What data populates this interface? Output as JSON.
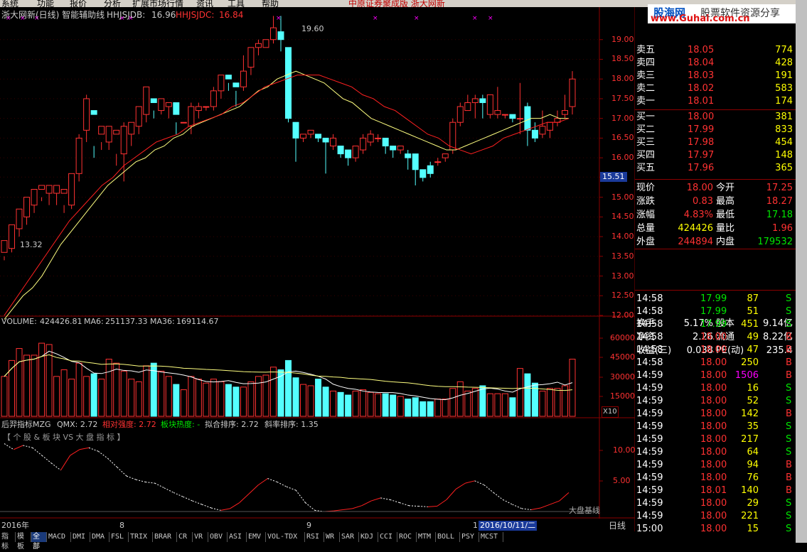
{
  "menu": [
    "系统",
    "功能",
    "报价",
    "分析",
    "扩展市场行情",
    "资讯",
    "工具",
    "帮助"
  ],
  "banner": "中原证券聚成版  浙大网新",
  "chart_header": {
    "title": "浙大网新(日线) 智能辅助线",
    "l1_label": "HHJSJDB:",
    "l1_value": "16.96",
    "l2_label": "HHJSJDC:",
    "l2_value": "16.84"
  },
  "logo": {
    "brand": "股海网",
    "slogan": "股票软件资源分享",
    "url": "www.Guhai.com.cn"
  },
  "price_axis": [
    "19.00",
    "18.50",
    "18.00",
    "17.50",
    "17.00",
    "16.50",
    "16.00",
    "15.51",
    "15.00",
    "14.50",
    "14.00",
    "13.50",
    "13.00",
    "12.50",
    "12.00"
  ],
  "annot": {
    "high": "19.60",
    "low": "13.32"
  },
  "volume_header": {
    "label": "VOLUME:",
    "volume": "424426.81",
    "ma6_label": "MA6:",
    "ma6": "251137.33",
    "ma36_label": "MA36:",
    "ma36": "169114.67"
  },
  "volume_axis": [
    "60000",
    "45000",
    "30000",
    "15000"
  ],
  "volume_unit": "X10",
  "indicator_header": {
    "name": "后羿指标MZG",
    "qmx": "QMX: 2.72",
    "rel": "相对强度: 2.72",
    "heat": "板块热度: -",
    "fit": "拟合排序: 2.72",
    "slope": "斜率排序: 1.35"
  },
  "indicator_sub": "【 个 股 & 板 块 VS 大 盘 指 标 】",
  "indicator_axis": [
    "10.00",
    "5.00"
  ],
  "indicator_note": "大盘基线",
  "date_axis": {
    "year": "2016年",
    "m8": "8",
    "m9": "9",
    "m10": "1",
    "cursor": "2016/10/11/二"
  },
  "period": "日线",
  "tabs": [
    "指标",
    "模板",
    "全部",
    "MACD",
    "DMI",
    "DMA",
    "FSL",
    "TRIX",
    "BRAR",
    "CR",
    "VR",
    "OBV",
    "ASI",
    "EMV",
    "VOL-TDX",
    "RSI",
    "WR",
    "SAR",
    "KDJ",
    "CCI",
    "ROC",
    "MTM",
    "BOLL",
    "PSY",
    "MCST"
  ],
  "orderbook": {
    "asks": [
      {
        "label": "卖五",
        "price": "18.05",
        "vol": "774"
      },
      {
        "label": "卖四",
        "price": "18.04",
        "vol": "428"
      },
      {
        "label": "卖三",
        "price": "18.03",
        "vol": "191"
      },
      {
        "label": "卖二",
        "price": "18.02",
        "vol": "583"
      },
      {
        "label": "卖一",
        "price": "18.01",
        "vol": "174"
      }
    ],
    "bids": [
      {
        "label": "买一",
        "price": "18.00",
        "vol": "381"
      },
      {
        "label": "买二",
        "price": "17.99",
        "vol": "833"
      },
      {
        "label": "买三",
        "price": "17.98",
        "vol": "454"
      },
      {
        "label": "买四",
        "price": "17.97",
        "vol": "148"
      },
      {
        "label": "买五",
        "price": "17.96",
        "vol": "365"
      }
    ]
  },
  "stats": [
    {
      "l1": "现价",
      "v1": "18.00",
      "l2": "今开",
      "v2": "17.25"
    },
    {
      "l1": "涨跌",
      "v1": "0.83",
      "l2": "最高",
      "v2": "18.27"
    },
    {
      "l1": "涨幅",
      "v1": "4.83%",
      "l2": "最低",
      "v2": "17.18"
    },
    {
      "l1": "总量",
      "v1": "424426",
      "l2": "量比",
      "v2": "1.96"
    },
    {
      "l1": "外盘",
      "v1": "244894",
      "l2": "内盘",
      "v2": "179532"
    },
    {
      "l1": "换手",
      "v1": "5.17%",
      "l2": "股本",
      "v2": "9.14亿"
    },
    {
      "l1": "净资",
      "v1": "2.26",
      "l2": "流通",
      "v2": "8.22亿"
    },
    {
      "l1": "收益(三)",
      "v1": "0.038",
      "l2": "PE(动)",
      "v2": "235.4"
    }
  ],
  "ticks": [
    {
      "t": "14:58",
      "p": "17.99",
      "v": "87",
      "s": "S"
    },
    {
      "t": "14:58",
      "p": "17.99",
      "v": "51",
      "s": "S"
    },
    {
      "t": "14:58",
      "p": "17.99",
      "v": "451",
      "s": "S"
    },
    {
      "t": "14:58",
      "p": "18.00",
      "v": "49",
      "s": "B"
    },
    {
      "t": "14:58",
      "p": "18.00",
      "v": "47",
      "s": "B"
    },
    {
      "t": "14:58",
      "p": "18.00",
      "v": "250",
      "s": "B"
    },
    {
      "t": "14:59",
      "p": "18.00",
      "v": "1506",
      "s": "B"
    },
    {
      "t": "14:59",
      "p": "18.00",
      "v": "16",
      "s": "S"
    },
    {
      "t": "14:59",
      "p": "18.00",
      "v": "52",
      "s": "S"
    },
    {
      "t": "14:59",
      "p": "18.00",
      "v": "142",
      "s": "B"
    },
    {
      "t": "14:59",
      "p": "18.00",
      "v": "35",
      "s": "S"
    },
    {
      "t": "14:59",
      "p": "18.00",
      "v": "217",
      "s": "S"
    },
    {
      "t": "14:59",
      "p": "18.00",
      "v": "64",
      "s": "S"
    },
    {
      "t": "14:59",
      "p": "18.00",
      "v": "94",
      "s": "B"
    },
    {
      "t": "14:59",
      "p": "18.00",
      "v": "76",
      "s": "B"
    },
    {
      "t": "14:59",
      "p": "18.01",
      "v": "140",
      "s": "B"
    },
    {
      "t": "14:59",
      "p": "18.00",
      "v": "29",
      "s": "S"
    },
    {
      "t": "14:59",
      "p": "18.00",
      "v": "221",
      "s": "S"
    },
    {
      "t": "15:00",
      "p": "18.00",
      "v": "15",
      "s": "S"
    }
  ],
  "colors": {
    "up": "#ff3232",
    "down": "#54ffff",
    "ma_short": "#ffff80",
    "ma_long": "#ff2020",
    "grid": "#8b0000"
  },
  "chart_data": {
    "type": "candlestick",
    "candles": [
      [
        13.6,
        13.9,
        13.5,
        13.4
      ],
      [
        13.7,
        14.3,
        14.2,
        13.6
      ],
      [
        14.2,
        14.7,
        14.5,
        14.0
      ],
      [
        14.5,
        15.0,
        14.9,
        14.3
      ],
      [
        14.8,
        15.2,
        15.1,
        14.6
      ],
      [
        15.2,
        15.3,
        15.0,
        14.9
      ],
      [
        15.1,
        15.3,
        15.2,
        14.8
      ],
      [
        15.1,
        15.3,
        15.2,
        14.8
      ],
      [
        15.1,
        15.2,
        14.8,
        14.6
      ],
      [
        14.8,
        15.6,
        15.6,
        14.7
      ],
      [
        15.6,
        16.5,
        16.6,
        15.4
      ],
      [
        16.7,
        17.5,
        17.6,
        16.4
      ],
      [
        17.2,
        17.1,
        16.3,
        16.0
      ],
      [
        16.6,
        16.8,
        16.4,
        16.2
      ],
      [
        16.4,
        16.8,
        16.6,
        16.2
      ],
      [
        16.6,
        16.7,
        16.1,
        15.8
      ],
      [
        16.1,
        16.8,
        16.9,
        15.4
      ],
      [
        16.6,
        16.9,
        16.8,
        16.3
      ],
      [
        16.8,
        17.3,
        17.3,
        16.6
      ],
      [
        17.1,
        17.8,
        17.8,
        16.9
      ],
      [
        17.5,
        17.4,
        17.2,
        17.0
      ],
      [
        17.2,
        17.5,
        17.4,
        17.1
      ],
      [
        17.3,
        17.4,
        17.4,
        17.0
      ],
      [
        17.4,
        17.1,
        16.9,
        16.6
      ],
      [
        16.9,
        16.9,
        16.6,
        16.6
      ],
      [
        16.8,
        17.3,
        17.4,
        16.6
      ],
      [
        17.2,
        17.3,
        17.4,
        17.0
      ],
      [
        17.3,
        17.3,
        17.3,
        17.2
      ],
      [
        17.3,
        17.7,
        17.8,
        17.2
      ],
      [
        17.7,
        18.1,
        18.1,
        17.5
      ],
      [
        18.1,
        18.0,
        17.9,
        17.7
      ],
      [
        17.9,
        17.8,
        17.7,
        17.3
      ],
      [
        17.8,
        18.2,
        18.6,
        17.7
      ],
      [
        18.3,
        18.8,
        18.8,
        18.1
      ],
      [
        18.8,
        18.9,
        19.0,
        18.6
      ],
      [
        18.8,
        19.0,
        19.0,
        18.8
      ],
      [
        19.0,
        19.3,
        19.6,
        18.9
      ],
      [
        19.2,
        19.0,
        19.6,
        18.7
      ],
      [
        18.8,
        17.0,
        18.8,
        16.9
      ],
      [
        16.9,
        16.5,
        16.9,
        15.9
      ],
      [
        16.5,
        16.6,
        16.6,
        16.4
      ],
      [
        16.6,
        16.7,
        16.7,
        16.5
      ],
      [
        16.6,
        16.5,
        16.6,
        16.4
      ],
      [
        16.5,
        16.4,
        16.5,
        15.6
      ],
      [
        16.3,
        16.5,
        16.6,
        16.2
      ],
      [
        16.3,
        16.1,
        16.3,
        16.0
      ],
      [
        16.2,
        16.0,
        16.2,
        15.8
      ],
      [
        16.0,
        16.3,
        16.3,
        15.9
      ],
      [
        16.2,
        16.5,
        16.6,
        16.1
      ],
      [
        16.4,
        16.6,
        16.7,
        16.3
      ],
      [
        16.5,
        16.5,
        16.6,
        16.4
      ],
      [
        16.5,
        16.3,
        16.4,
        16.1
      ],
      [
        16.3,
        16.2,
        16.3,
        16.0
      ],
      [
        16.2,
        16.3,
        16.3,
        16.1
      ],
      [
        16.1,
        16.0,
        16.2,
        15.7
      ],
      [
        16.1,
        15.7,
        16.1,
        15.3
      ],
      [
        15.7,
        15.5,
        15.7,
        15.4
      ],
      [
        15.8,
        15.6,
        15.9,
        15.5
      ],
      [
        15.9,
        15.9,
        16.0,
        15.8
      ],
      [
        16.0,
        16.1,
        16.1,
        15.9
      ],
      [
        16.2,
        16.9,
        17.0,
        16.1
      ],
      [
        16.9,
        17.3,
        17.4,
        16.8
      ],
      [
        17.2,
        17.4,
        17.6,
        17.2
      ],
      [
        17.4,
        17.5,
        17.6,
        17.0
      ],
      [
        17.5,
        17.4,
        17.6,
        17.0
      ],
      [
        17.1,
        17.6,
        17.6,
        17.0
      ],
      [
        17.1,
        17.2,
        17.8,
        17.0
      ],
      [
        17.1,
        17.1,
        17.1,
        17.0
      ],
      [
        17.1,
        17.0,
        17.0,
        16.9
      ],
      [
        17.0,
        17.0,
        17.9,
        16.6
      ],
      [
        17.3,
        16.7,
        17.4,
        16.3
      ],
      [
        16.7,
        16.5,
        16.9,
        16.4
      ],
      [
        16.6,
        16.8,
        17.2,
        16.5
      ],
      [
        16.7,
        16.9,
        16.9,
        16.5
      ],
      [
        16.9,
        17.0,
        17.2,
        16.8
      ],
      [
        17.1,
        17.2,
        17.6,
        17.0
      ],
      [
        17.3,
        18.0,
        18.2,
        17.1
      ]
    ],
    "candle_format": "open,close,high,low",
    "volume": [
      30000,
      42000,
      51000,
      46000,
      46000,
      55000,
      54000,
      30000,
      35000,
      28000,
      40000,
      30000,
      32000,
      28000,
      43000,
      40000,
      34000,
      28000,
      26000,
      38000,
      40000,
      34000,
      30000,
      24000,
      20000,
      30000,
      28000,
      25000,
      28000,
      26000,
      24000,
      22000,
      22000,
      26000,
      30000,
      31000,
      37000,
      35000,
      42000,
      29000,
      24000,
      23000,
      28000,
      22000,
      19000,
      18000,
      16000,
      19000,
      20000,
      18000,
      17000,
      17000,
      16000,
      15000,
      13000,
      14000,
      11000,
      11000,
      13000,
      13000,
      21000,
      26000,
      19000,
      21000,
      23000,
      17000,
      17000,
      17000,
      14000,
      36000,
      32000,
      25000,
      19000,
      21000,
      21000,
      23000,
      43000
    ],
    "ma_short": [
      11.9,
      12.2,
      12.5,
      12.7,
      13.0,
      13.4,
      13.8,
      14.1,
      14.4,
      14.7,
      15.0,
      15.3,
      15.5,
      15.7,
      15.9,
      16.0,
      16.2,
      16.3,
      16.5,
      16.6,
      16.8,
      16.9,
      17.0,
      17.1,
      17.2,
      17.3,
      17.5,
      17.7,
      17.8,
      18.0,
      18.1,
      18.2,
      18.1,
      18.0,
      17.9,
      17.7,
      17.5,
      17.4,
      17.2,
      17.0,
      16.9,
      16.8,
      16.7,
      16.6,
      16.5,
      16.4,
      16.3,
      16.2,
      16.2,
      16.3,
      16.4,
      16.5,
      16.6,
      16.7,
      16.8,
      16.9,
      17.0,
      17.0,
      17.1,
      17.0,
      17.0
    ],
    "ma_long": [
      12.0,
      12.4,
      12.8,
      13.2,
      13.6,
      14.0,
      14.4,
      14.7,
      15.0,
      15.3,
      15.5,
      15.8,
      16.0,
      16.2,
      16.4,
      16.5,
      16.6,
      16.8,
      16.9,
      17.0,
      17.1,
      17.3,
      17.4,
      17.6,
      17.8,
      17.9,
      18.0,
      18.1,
      18.1,
      18.1,
      18.0,
      17.9,
      17.8,
      17.6,
      17.5,
      17.3,
      17.2,
      17.0,
      16.8,
      16.6,
      16.5,
      16.3,
      16.2,
      16.1,
      16.2,
      16.3,
      16.5,
      16.6,
      16.7,
      16.8,
      16.9,
      16.9,
      17.0
    ],
    "ylim": [
      12.0,
      19.5
    ]
  }
}
